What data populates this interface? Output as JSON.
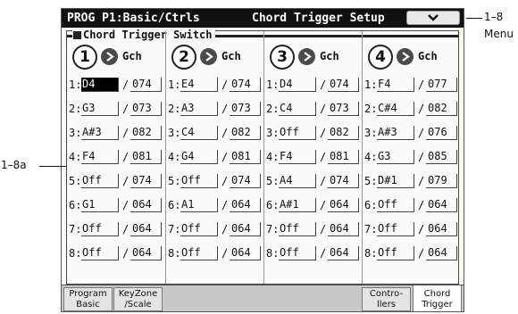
{
  "title": {
    "mode_page": "PROG P1:Basic/Ctrls",
    "page_name": "Chord Trigger Setup"
  },
  "section_label": "Chord Trigger Switch",
  "columns": [
    {
      "number": "1",
      "channel": "Gch",
      "rows": [
        {
          "idx": "1:",
          "note": "D4",
          "vel": "074"
        },
        {
          "idx": "2:",
          "note": "G3",
          "vel": "073"
        },
        {
          "idx": "3:",
          "note": "A#3",
          "vel": "082"
        },
        {
          "idx": "4:",
          "note": "F4",
          "vel": "081"
        },
        {
          "idx": "5:",
          "note": "Off",
          "vel": "074"
        },
        {
          "idx": "6:",
          "note": "G1",
          "vel": "064"
        },
        {
          "idx": "7:",
          "note": "Off",
          "vel": "064"
        },
        {
          "idx": "8:",
          "note": "Off",
          "vel": "064"
        }
      ]
    },
    {
      "number": "2",
      "channel": "Gch",
      "rows": [
        {
          "idx": "1:",
          "note": "E4",
          "vel": "074"
        },
        {
          "idx": "2:",
          "note": "A3",
          "vel": "073"
        },
        {
          "idx": "3:",
          "note": "C4",
          "vel": "082"
        },
        {
          "idx": "4:",
          "note": "G4",
          "vel": "081"
        },
        {
          "idx": "5:",
          "note": "Off",
          "vel": "074"
        },
        {
          "idx": "6:",
          "note": "A1",
          "vel": "064"
        },
        {
          "idx": "7:",
          "note": "Off",
          "vel": "064"
        },
        {
          "idx": "8:",
          "note": "Off",
          "vel": "064"
        }
      ]
    },
    {
      "number": "3",
      "channel": "Gch",
      "rows": [
        {
          "idx": "1:",
          "note": "D4",
          "vel": "074"
        },
        {
          "idx": "2:",
          "note": "C4",
          "vel": "073"
        },
        {
          "idx": "3:",
          "note": "Off",
          "vel": "082"
        },
        {
          "idx": "4:",
          "note": "F4",
          "vel": "081"
        },
        {
          "idx": "5:",
          "note": "A4",
          "vel": "074"
        },
        {
          "idx": "6:",
          "note": "A#1",
          "vel": "064"
        },
        {
          "idx": "7:",
          "note": "Off",
          "vel": "064"
        },
        {
          "idx": "8:",
          "note": "Off",
          "vel": "064"
        }
      ]
    },
    {
      "number": "4",
      "channel": "Gch",
      "rows": [
        {
          "idx": "1:",
          "note": "F4",
          "vel": "077"
        },
        {
          "idx": "2:",
          "note": "C#4",
          "vel": "082"
        },
        {
          "idx": "3:",
          "note": "A#3",
          "vel": "076"
        },
        {
          "idx": "4:",
          "note": "G3",
          "vel": "085"
        },
        {
          "idx": "5:",
          "note": "D#1",
          "vel": "079"
        },
        {
          "idx": "6:",
          "note": "Off",
          "vel": "064"
        },
        {
          "idx": "7:",
          "note": "Off",
          "vel": "064"
        },
        {
          "idx": "8:",
          "note": "Off",
          "vel": "064"
        }
      ]
    }
  ],
  "slash": "/",
  "tabs": [
    {
      "line1": "Program",
      "line2": "Basic"
    },
    {
      "line1": "KeyZone",
      "line2": "/Scale"
    },
    {
      "line1": "Contro-",
      "line2": "llers"
    },
    {
      "line1": "Chord",
      "line2": "Trigger"
    }
  ],
  "callouts": {
    "menu_ref": "1–8",
    "menu_label": "Menu",
    "left_ref": "1–8a"
  },
  "selected_cell": "col1-row1-note",
  "icons": {
    "menu": "chevron-down-icon",
    "channel": "right-arrow-circle-icon"
  }
}
